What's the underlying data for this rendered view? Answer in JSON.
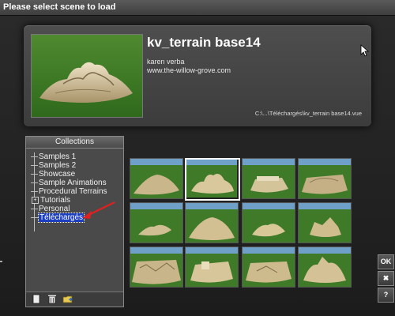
{
  "window": {
    "title": "Please select scene to load"
  },
  "preview": {
    "scene_name": "kv_terrain base14",
    "author": "karen verba",
    "url": "www.the-willow-grove.com",
    "path": "C:\\...\\Téléchargés\\kv_terrain base14.vue"
  },
  "collections": {
    "header": "Collections",
    "items": [
      {
        "label": "Samples 1"
      },
      {
        "label": "Samples 2"
      },
      {
        "label": "Showcase"
      },
      {
        "label": "Sample Animations"
      },
      {
        "label": "Procedural Terrains"
      },
      {
        "label": "Tutorials"
      },
      {
        "label": "Personal"
      },
      {
        "label": "Téléchargés"
      }
    ],
    "selected": "Téléchargés",
    "footer_icons": [
      "new-collection-icon",
      "delete-collection-icon",
      "folder-icon"
    ]
  },
  "grid": {
    "rows": 3,
    "columns": 4,
    "selected_index": 1
  },
  "buttons": {
    "ok": "OK",
    "cancel": "✖",
    "help": "?"
  },
  "colors": {
    "selection": "#1c3fbf",
    "arrow": "#e02020",
    "grass": "#3f7a28",
    "sky": "#8fb7d9"
  }
}
